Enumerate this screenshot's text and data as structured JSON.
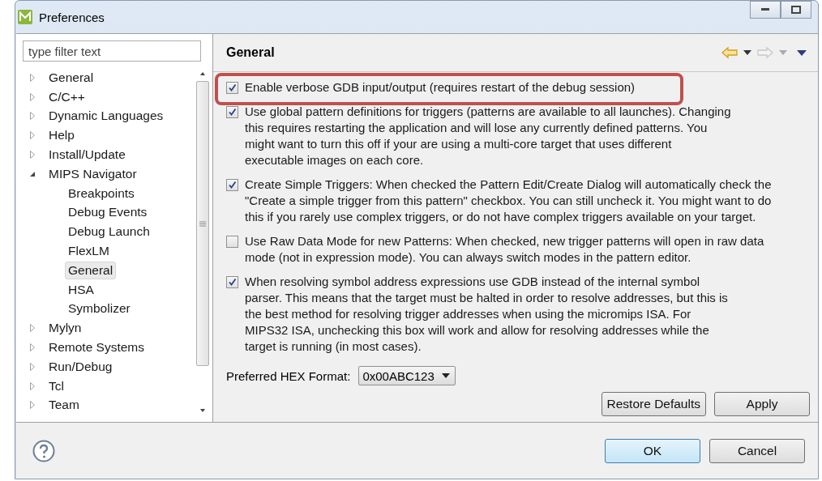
{
  "window": {
    "title": "Preferences"
  },
  "filter": {
    "placeholder": "type filter text"
  },
  "tree": [
    {
      "label": "General",
      "expanded": false,
      "selected": false
    },
    {
      "label": "C/C++",
      "expanded": false,
      "selected": false
    },
    {
      "label": "Dynamic Languages",
      "expanded": false,
      "selected": false
    },
    {
      "label": "Help",
      "expanded": false,
      "selected": false
    },
    {
      "label": "Install/Update",
      "expanded": false,
      "selected": false
    },
    {
      "label": "MIPS Navigator",
      "expanded": true,
      "selected": false,
      "children": [
        {
          "label": "Breakpoints",
          "selected": false
        },
        {
          "label": "Debug Events",
          "selected": false
        },
        {
          "label": "Debug Launch",
          "selected": false
        },
        {
          "label": "FlexLM",
          "selected": false
        },
        {
          "label": "General",
          "selected": true
        },
        {
          "label": "HSA",
          "selected": false
        },
        {
          "label": "Symbolizer",
          "selected": false
        }
      ]
    },
    {
      "label": "Mylyn",
      "expanded": false,
      "selected": false
    },
    {
      "label": "Remote Systems",
      "expanded": false,
      "selected": false
    },
    {
      "label": "Run/Debug",
      "expanded": false,
      "selected": false
    },
    {
      "label": "Tcl",
      "expanded": false,
      "selected": false
    },
    {
      "label": "Team",
      "expanded": false,
      "selected": false
    }
  ],
  "page": {
    "title": "General",
    "options": [
      {
        "label": "Enable verbose GDB input/output (requires restart of the debug session)",
        "checked": true,
        "highlighted": true
      },
      {
        "label": "Use global pattern definitions for triggers (patterns are available to all launches). Changing this requires restarting the application and will lose any currently defined patterns. You might want to turn this off if your are using a multi-core target that uses different executable images on each core.",
        "checked": true,
        "highlighted": false
      },
      {
        "label": "Create Simple Triggers: When checked the Pattern Edit/Create Dialog will automatically check the \"Create a simple trigger from this pattern\" checkbox.  You can still uncheck it.  You might want to do this if you rarely use complex triggers, or do not have complex triggers available on your target.",
        "checked": true,
        "highlighted": false
      },
      {
        "label": "Use Raw Data Mode for new Patterns: When checked, new trigger patterns will open in raw data mode (not in expression mode).  You can always switch modes in the pattern editor.",
        "checked": false,
        "highlighted": false
      },
      {
        "label": "When resolving symbol address expressions use GDB instead of the internal symbol parser.  This means that the target must be halted in order to resolve addresses, but this is the best method for resolving trigger addresses when using the micromips ISA.  For MIPS32 ISA, unchecking this box will work and allow for resolving addresses while the target is running (in most cases).",
        "checked": true,
        "highlighted": false
      }
    ],
    "hex_format": {
      "label": "Preferred HEX Format:",
      "value": "0x00ABC123"
    },
    "buttons": [
      "Restore Defaults",
      "Apply"
    ]
  },
  "dialog_buttons": [
    {
      "label": "OK",
      "default": true
    },
    {
      "label": "Cancel",
      "default": false
    }
  ]
}
